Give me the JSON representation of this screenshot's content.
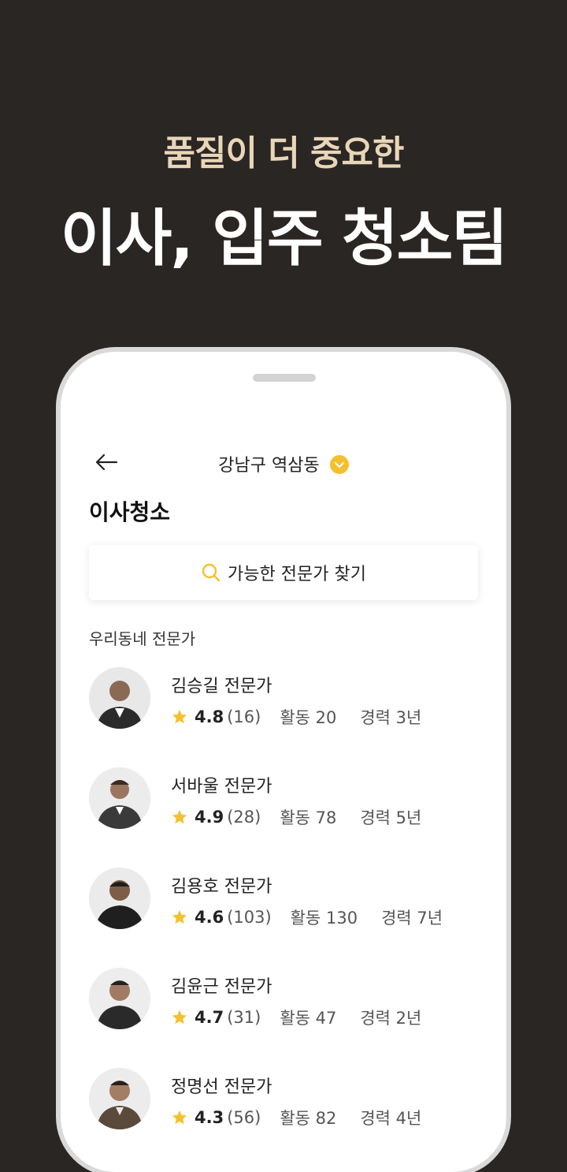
{
  "promo": {
    "subtitle": "품질이 더 중요한",
    "headline": "이사, 입주 청소팀"
  },
  "header": {
    "location": "강남구 역삼동",
    "back_icon": "arrow-left-icon",
    "chevron_icon": "chevron-down-icon"
  },
  "page": {
    "title": "이사청소",
    "search_label": "가능한 전문가 찾기",
    "section_label": "우리동네 전문가"
  },
  "colors": {
    "background": "#2a2624",
    "subtitle": "#e9d6b8",
    "accent": "#f5c02f",
    "star": "#f5c02f"
  },
  "experts": [
    {
      "name": "김승길 전문가",
      "rating": "4.8",
      "count": "(16)",
      "activity": "활동 20",
      "career": "경력 3년"
    },
    {
      "name": "서바울 전문가",
      "rating": "4.9",
      "count": "(28)",
      "activity": "활동 78",
      "career": "경력 5년"
    },
    {
      "name": "김용호 전문가",
      "rating": "4.6",
      "count": "(103)",
      "activity": "활동 130",
      "career": "경력 7년"
    },
    {
      "name": "김윤근 전문가",
      "rating": "4.7",
      "count": "(31)",
      "activity": "활동 47",
      "career": "경력 2년"
    },
    {
      "name": "정명선 전문가",
      "rating": "4.3",
      "count": "(56)",
      "activity": "활동 82",
      "career": "경력 4년"
    }
  ]
}
